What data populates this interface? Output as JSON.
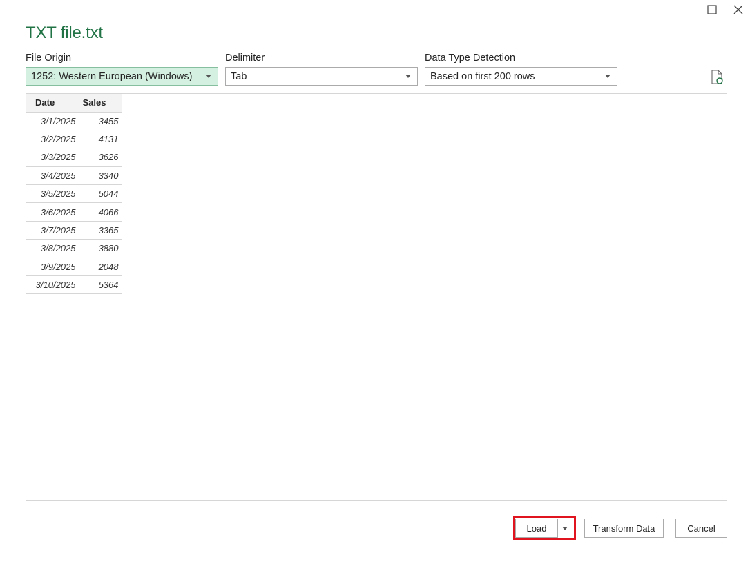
{
  "window": {
    "title": "TXT file.txt"
  },
  "options": {
    "file_origin": {
      "label": "File Origin",
      "value": "1252: Western European (Windows)"
    },
    "delimiter": {
      "label": "Delimiter",
      "value": "Tab"
    },
    "data_type_detection": {
      "label": "Data Type Detection",
      "value": "Based on first 200 rows"
    }
  },
  "preview": {
    "columns": [
      "Date",
      "Sales"
    ],
    "rows": [
      [
        "3/1/2025",
        "3455"
      ],
      [
        "3/2/2025",
        "4131"
      ],
      [
        "3/3/2025",
        "3626"
      ],
      [
        "3/4/2025",
        "3340"
      ],
      [
        "3/5/2025",
        "5044"
      ],
      [
        "3/6/2025",
        "4066"
      ],
      [
        "3/7/2025",
        "3365"
      ],
      [
        "3/8/2025",
        "3880"
      ],
      [
        "3/9/2025",
        "2048"
      ],
      [
        "3/10/2025",
        "5364"
      ]
    ]
  },
  "footer": {
    "load_label": "Load",
    "transform_label": "Transform Data",
    "cancel_label": "Cancel"
  },
  "icons": {
    "maximize": "maximize-icon",
    "close": "close-icon",
    "refresh": "refresh-file-icon",
    "dropdown": "chevron-down-icon"
  },
  "colors": {
    "accent": "#217346",
    "selected_field_bg": "#d3f0e0",
    "highlight_border": "#e0141e"
  }
}
